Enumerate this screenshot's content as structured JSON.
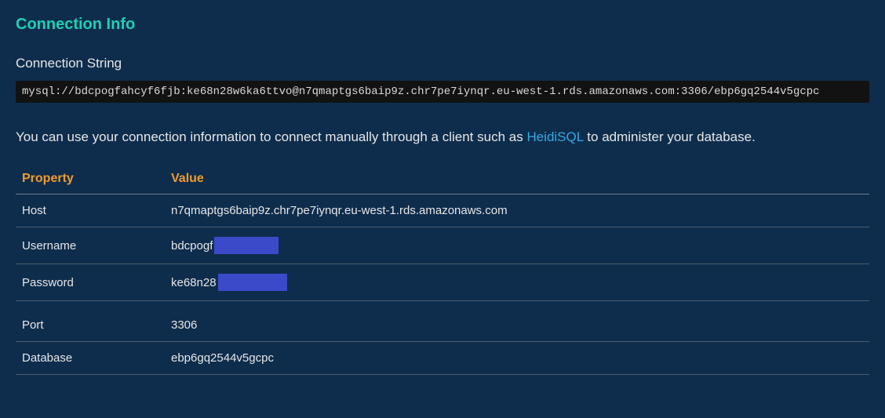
{
  "panel": {
    "title": "Connection Info"
  },
  "connectionString": {
    "label": "Connection String",
    "value": "mysql://bdcpogfahcyf6fjb:ke68n28w6ka6ttvo@n7qmaptgs6baip9z.chr7pe7iynqr.eu-west-1.rds.amazonaws.com:3306/ebp6gq2544v5gcpc"
  },
  "infoText": {
    "prefix": "You can use your connection information to connect manually through a client such as ",
    "linkText": "HeidiSQL",
    "suffix": " to administer your database."
  },
  "table": {
    "headers": {
      "property": "Property",
      "value": "Value"
    },
    "rows": {
      "host": {
        "label": "Host",
        "value": "n7qmaptgs6baip9z.chr7pe7iynqr.eu-west-1.rds.amazonaws.com"
      },
      "username": {
        "label": "Username",
        "valueVisible": "bdcpogf"
      },
      "password": {
        "label": "Password",
        "valueVisible": "ke68n28"
      },
      "port": {
        "label": "Port",
        "value": "3306"
      },
      "database": {
        "label": "Database",
        "value": "ebp6gq2544v5gcpc"
      }
    }
  }
}
